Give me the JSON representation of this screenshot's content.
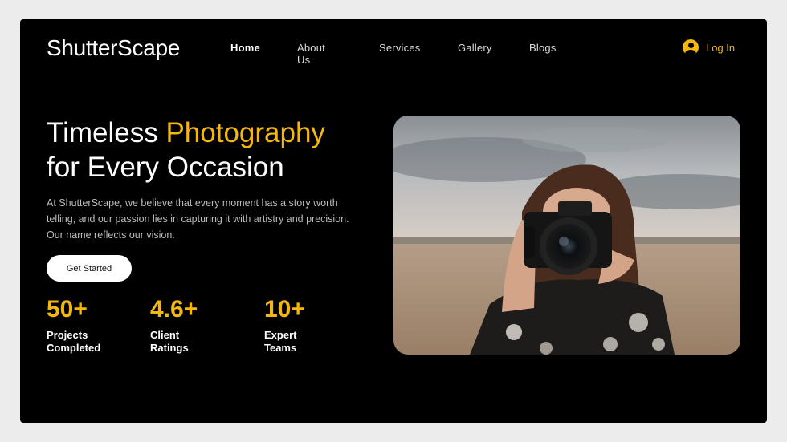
{
  "brand": {
    "name": "ShutterScape"
  },
  "nav": {
    "items": [
      {
        "label": "Home",
        "active": true
      },
      {
        "label": "About Us"
      },
      {
        "label": "Services"
      },
      {
        "label": "Gallery"
      },
      {
        "label": "Blogs"
      }
    ],
    "login_label": "Log In"
  },
  "hero": {
    "title_part1": "Timeless ",
    "title_accent": "Photography",
    "title_line2": "for Every Occasion",
    "description": "At ShutterScape, we believe that every moment has a story worth telling, and our passion lies in capturing it with artistry and precision. Our name reflects our vision.",
    "cta_label": "Get Started"
  },
  "stats": [
    {
      "value": "50+",
      "label": "Projects Completed"
    },
    {
      "value": "4.6+",
      "label": "Client Ratings"
    },
    {
      "value": "10+",
      "label": "Expert Teams"
    }
  ],
  "colors": {
    "accent": "#f4b70f",
    "background": "#000000",
    "frame": "#ececec"
  },
  "icons": {
    "login": "user-circle-icon"
  }
}
